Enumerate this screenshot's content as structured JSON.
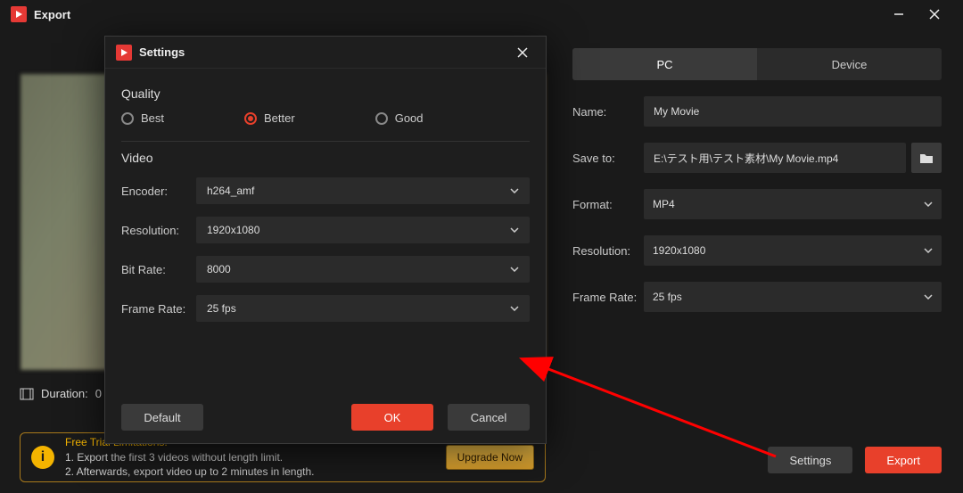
{
  "window": {
    "title": "Export"
  },
  "preview": {
    "duration_label": "Duration:",
    "duration_value": "0"
  },
  "trial": {
    "heading": "Free Trial Limitations:",
    "line1": "1. Export the first 3 videos without length limit.",
    "line2": "2. Afterwards, export video up to 2 minutes in length.",
    "upgrade": "Upgrade Now"
  },
  "tabs": {
    "pc": "PC",
    "device": "Device"
  },
  "form": {
    "name_label": "Name:",
    "name_value": "My Movie",
    "save_label": "Save to:",
    "save_value": "E:\\テスト用\\テスト素材\\My Movie.mp4",
    "format_label": "Format:",
    "format_value": "MP4",
    "resolution_label": "Resolution:",
    "resolution_value": "1920x1080",
    "framerate_label": "Frame Rate:",
    "framerate_value": "25 fps"
  },
  "buttons": {
    "settings": "Settings",
    "export": "Export"
  },
  "modal": {
    "title": "Settings",
    "quality_header": "Quality",
    "quality": {
      "best": "Best",
      "better": "Better",
      "good": "Good",
      "selected": "Better"
    },
    "video_header": "Video",
    "encoder_label": "Encoder:",
    "encoder_value": "h264_amf",
    "resolution_label": "Resolution:",
    "resolution_value": "1920x1080",
    "bitrate_label": "Bit Rate:",
    "bitrate_value": "8000",
    "framerate_label": "Frame Rate:",
    "framerate_value": "25 fps",
    "default": "Default",
    "ok": "OK",
    "cancel": "Cancel"
  }
}
